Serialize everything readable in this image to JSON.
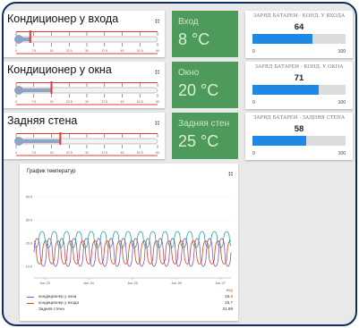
{
  "thermometers": [
    {
      "title": "Кондиционер у входа",
      "temp": 8
    },
    {
      "title": "Кондиционер у окна",
      "temp": 20
    },
    {
      "title": "Задняя стена",
      "temp": 25
    }
  ],
  "thermo_scale": {
    "min": 0,
    "max": 80
  },
  "temp_tiles": [
    {
      "label": "Вход",
      "value": "8 °C"
    },
    {
      "label": "Окно",
      "value": "20 °C"
    },
    {
      "label": "Задняя стен",
      "value": "25 °C"
    }
  ],
  "batteries": [
    {
      "title": "ЗАРЯД БАТАРЕИ - КОНД. У ВХОДА",
      "value": "64",
      "fraction": 0.64,
      "min": "0",
      "max": "100"
    },
    {
      "title": "ЗАРЯД БАТАРЕИ - КОНД. У ОКНА",
      "value": "71",
      "fraction": 0.71,
      "min": "0",
      "max": "100"
    },
    {
      "title": "ЗАРЯД БАТАРЕИ - ЗАДНЯЯ СТЕНА",
      "value": "58",
      "fraction": 0.58,
      "min": "0",
      "max": "100"
    }
  ],
  "graph": {
    "title": "График температур",
    "legend_header": "avg",
    "legend": [
      {
        "name": "кондиционер у окна",
        "value": "16.4",
        "color": "#7e57c2"
      },
      {
        "name": "кондиционер у входа",
        "value": "15.7",
        "color": "#d84315"
      },
      {
        "name": "Задняя стена",
        "value": "21.89",
        "color": "#26a69a"
      }
    ]
  },
  "colors": {
    "green_tile": "#4e9a5a",
    "bar_fill": "#1e88e5",
    "thermo_red": "#e53935",
    "thermo_blue": "#90a4c8"
  },
  "chart_data": {
    "type": "line",
    "title": "График температур",
    "x": [
      "Jun 23",
      "Jun 24",
      "Jun 25",
      "Jun 26",
      "Jun 27"
    ],
    "ylim": [
      5,
      45
    ],
    "yticks": [
      "10.0",
      "20.0",
      "30.0",
      "40.0"
    ],
    "series": [
      {
        "name": "кондиционер у окна",
        "color": "#7e57c2",
        "low": 10,
        "high": 22,
        "avg": 16.4
      },
      {
        "name": "кондиционер у входа",
        "color": "#d84315",
        "low": 11,
        "high": 21,
        "avg": 15.7
      },
      {
        "name": "Задняя стена",
        "color": "#26a69a",
        "low": 18,
        "high": 25,
        "avg": 21.89
      }
    ]
  }
}
